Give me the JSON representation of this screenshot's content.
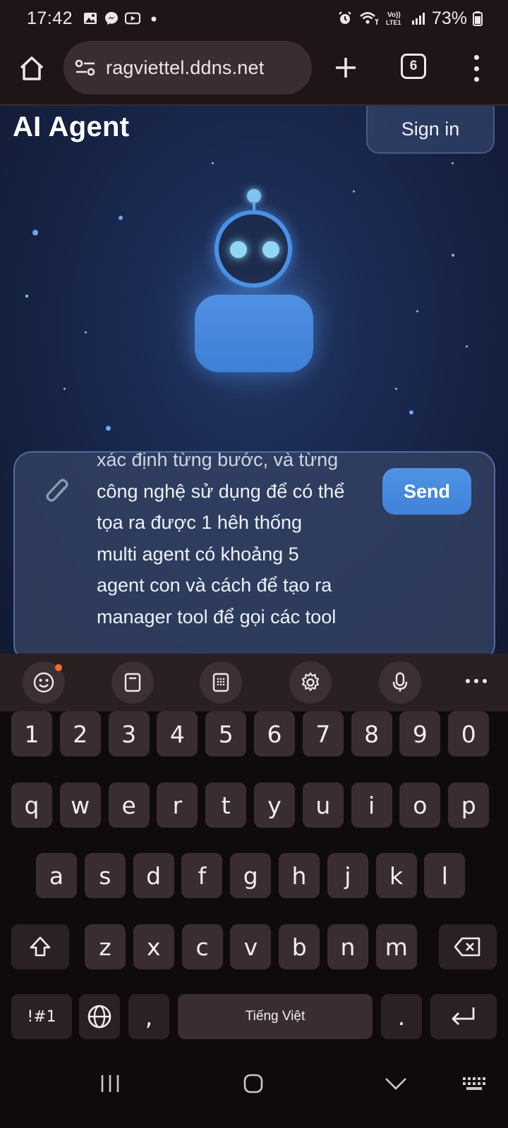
{
  "status_bar": {
    "time": "17:42",
    "notification_icons": [
      "gallery-icon",
      "messenger-icon",
      "youtube-icon",
      "dot-icon"
    ],
    "system_icons": [
      "alarm-icon",
      "wifi-icon",
      "volte-icon",
      "signal-icon"
    ],
    "battery_percent": "73%"
  },
  "browser": {
    "url": "ragviettel.ddns.net",
    "tab_count": "6"
  },
  "page": {
    "title": "AI Agent",
    "sign_in_label": "Sign in",
    "composer": {
      "cut_line": "xác định từng bước, và từng",
      "lines": [
        "công nghệ sử dụng để có thể",
        "tọa ra được 1 hêh thống",
        "multi agent có khoảng 5",
        "agent con và cách để tạo ra",
        "manager tool để gọi các tool"
      ],
      "send_label": "Send"
    }
  },
  "keyboard": {
    "toolbar": [
      "emoji-icon",
      "clipboard-icon",
      "keypad-icon",
      "settings-icon",
      "microphone-icon",
      "more-icon"
    ],
    "row_numbers": [
      "1",
      "2",
      "3",
      "4",
      "5",
      "6",
      "7",
      "8",
      "9",
      "0"
    ],
    "row_1": [
      "q",
      "w",
      "e",
      "r",
      "t",
      "y",
      "u",
      "i",
      "o",
      "p"
    ],
    "row_2": [
      "a",
      "s",
      "d",
      "f",
      "g",
      "h",
      "j",
      "k",
      "l"
    ],
    "row_3": [
      "z",
      "x",
      "c",
      "v",
      "b",
      "n",
      "m"
    ],
    "symbols_label": "!#1",
    "comma_label": ",",
    "space_label": "Tiếng Việt",
    "period_label": "."
  },
  "colors": {
    "accent_blue": "#4a8fe4",
    "page_bg": "#1a2a52",
    "keyboard_key": "#3a2d2f",
    "browser_bar": "#1f1516"
  }
}
